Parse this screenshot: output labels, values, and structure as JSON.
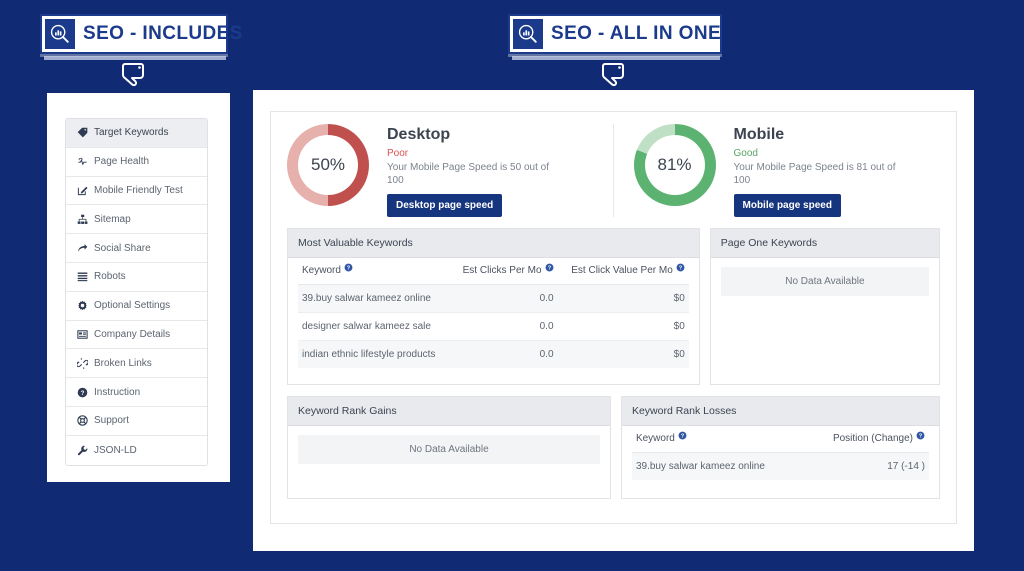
{
  "background_color": "#102a74",
  "accent_color": "#15357e",
  "badges": [
    {
      "logo_icon": "seo-magnifier-chart-icon",
      "title": "SEO - INCLUDES"
    },
    {
      "logo_icon": "seo-magnifier-chart-icon",
      "title": "SEO - ALL IN ONE"
    }
  ],
  "cursors": [
    {
      "icon": "pointing-hand-cursor-icon"
    },
    {
      "icon": "pointing-hand-cursor-icon"
    }
  ],
  "sidebar": {
    "items": [
      {
        "label": "Target Keywords",
        "icon": "tag-icon",
        "active": true
      },
      {
        "label": "Page Health",
        "icon": "heartbeat-icon",
        "active": false
      },
      {
        "label": "Mobile Friendly Test",
        "icon": "edit-square-icon",
        "active": false
      },
      {
        "label": "Sitemap",
        "icon": "sitemap-icon",
        "active": false
      },
      {
        "label": "Social Share",
        "icon": "share-arrow-icon",
        "active": false
      },
      {
        "label": "Robots",
        "icon": "list-lines-icon",
        "active": false
      },
      {
        "label": "Optional Settings",
        "icon": "gear-icon",
        "active": false
      },
      {
        "label": "Company Details",
        "icon": "building-icon",
        "active": false
      },
      {
        "label": "Broken Links",
        "icon": "broken-chain-icon",
        "active": false
      },
      {
        "label": "Instruction",
        "icon": "question-circle-icon",
        "active": false
      },
      {
        "label": "Support",
        "icon": "lifebuoy-icon",
        "active": false
      },
      {
        "label": "JSON-LD",
        "icon": "wrench-icon",
        "active": false
      }
    ]
  },
  "speed": {
    "desktop": {
      "percent_label": "50%",
      "percent_value": 50,
      "title": "Desktop",
      "rating": "Poor",
      "rating_color": "#d9534f",
      "arc_color": "#c0504d",
      "track_color": "#e6b0ac",
      "description": "Your Mobile Page Speed is 50 out of 100",
      "button_label": "Desktop page speed"
    },
    "mobile": {
      "percent_label": "81%",
      "percent_value": 81,
      "title": "Mobile",
      "rating": "Good",
      "rating_color": "#5aa469",
      "arc_color": "#5cb270",
      "track_color": "#bfe0c4",
      "description": "Your Mobile Page Speed is 81 out of 100",
      "button_label": "Mobile page speed"
    }
  },
  "panels": {
    "most_valuable_keywords": {
      "title": "Most Valuable Keywords",
      "columns": [
        "Keyword",
        "Est Clicks Per Mo",
        "Est Click Value Per Mo"
      ],
      "help_icon": "question-circle-icon",
      "rows": [
        {
          "keyword": "39.buy salwar kameez online",
          "clicks": "0.0",
          "value": "$0"
        },
        {
          "keyword": "designer salwar kameez sale",
          "clicks": "0.0",
          "value": "$0"
        },
        {
          "keyword": "indian ethnic lifestyle products",
          "clicks": "0.0",
          "value": "$0"
        }
      ]
    },
    "page_one_keywords": {
      "title": "Page One Keywords",
      "empty_label": "No Data Available"
    },
    "keyword_rank_gains": {
      "title": "Keyword Rank Gains",
      "empty_label": "No Data Available"
    },
    "keyword_rank_losses": {
      "title": "Keyword Rank Losses",
      "columns": [
        "Keyword",
        "Position (Change)"
      ],
      "help_icon": "question-circle-icon",
      "rows": [
        {
          "keyword": "39.buy salwar kameez online",
          "position": "17 (-14   )"
        }
      ]
    }
  }
}
